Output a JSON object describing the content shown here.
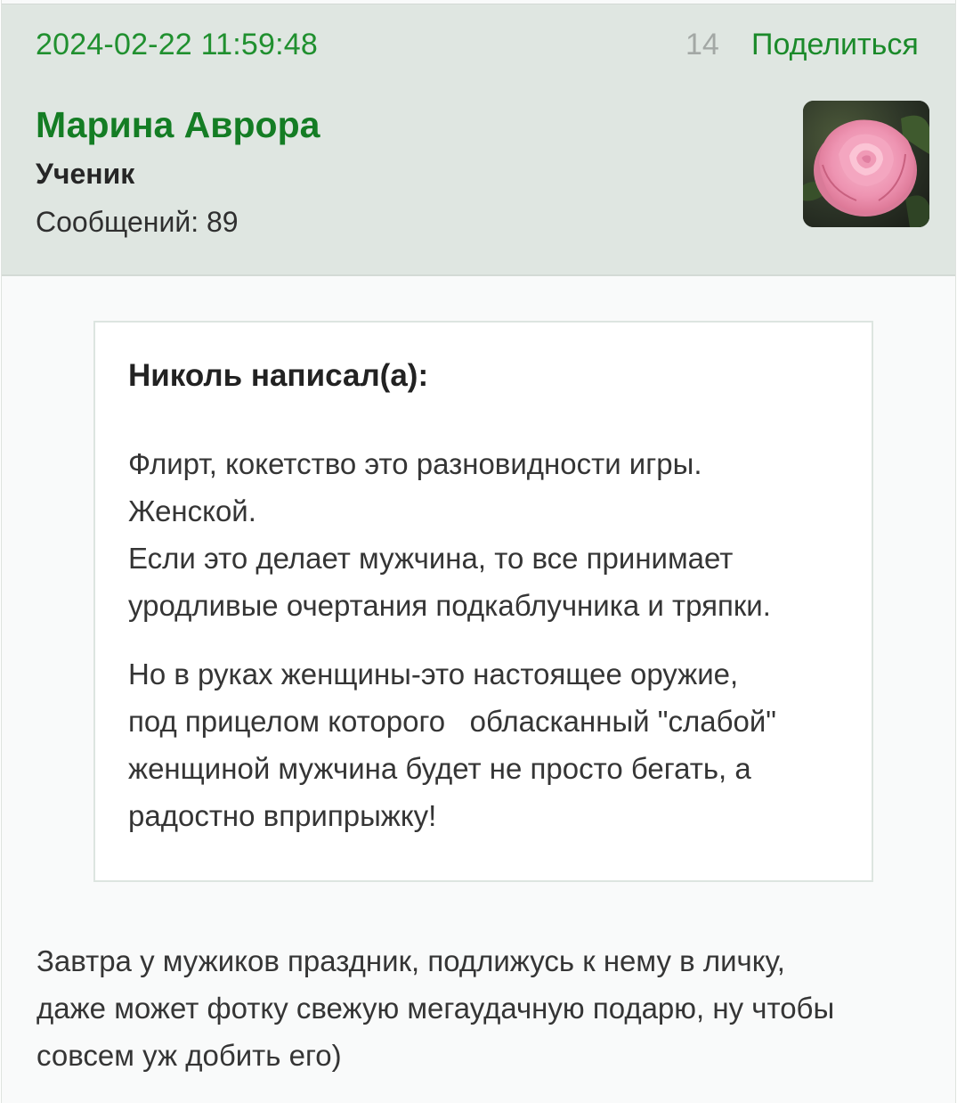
{
  "post": {
    "date": "2024-02-22 11:59:48",
    "number": "14",
    "share_label": "Поделиться"
  },
  "author": {
    "name": "Марина Аврора",
    "rank": "Ученик",
    "posts_label": "Сообщений: 89",
    "avatar_icon": "rose-avatar"
  },
  "quote": {
    "author_line": "Николь написал(а):",
    "paragraph1": [
      "Флирт, кокетство это разновидности игры.",
      "Женской.",
      "Если это делает мужчина, то все принимает",
      "уродливые очертания подкаблучника и тряпки."
    ],
    "paragraph2": [
      "Но в руках женщины-это настоящее оружие,",
      "под прицелом которого   обласканный \"слабой\"",
      "женщиной мужчина будет не просто бегать, а",
      "радостно вприпрыжку!"
    ]
  },
  "message": {
    "lines": [
      "Завтра у мужиков праздник, подлижусь к нему в личку,",
      "даже может фотку свежую мегаудачную подарю, ну чтобы",
      "совсем уж добить его)"
    ]
  },
  "colors": {
    "header_bg": "#dfe6e1",
    "accent_green": "#1b8a2a",
    "muted": "#a3a8a5"
  }
}
